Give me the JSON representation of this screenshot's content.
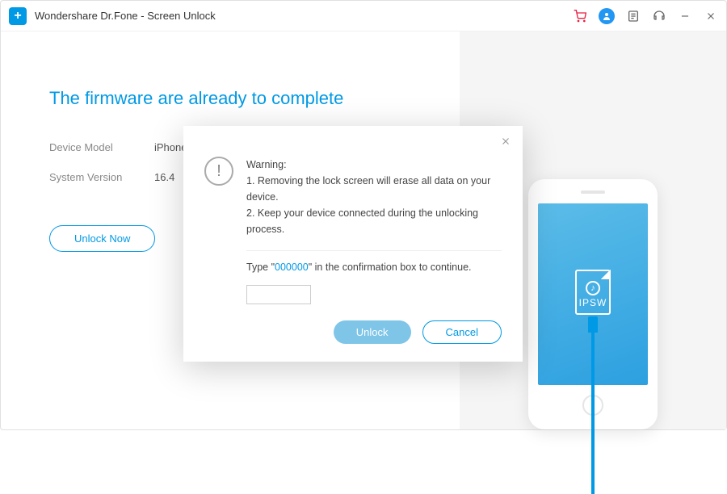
{
  "titlebar": {
    "app_name": "Wondershare Dr.Fone - Screen Unlock"
  },
  "main": {
    "headline": "The firmware are already to complete",
    "device_model_label": "Device Model",
    "device_model_value": "iPhone X",
    "system_version_label": "System Version",
    "system_version_value": "16.4",
    "unlock_now_label": "Unlock Now"
  },
  "phone": {
    "file_label": "IPSW"
  },
  "modal": {
    "warning_heading": "Warning:",
    "warning_line1": "1. Removing the lock screen will erase all data on your device.",
    "warning_line2": "2. Keep your device connected during the unlocking process.",
    "confirm_prefix": "Type \"",
    "confirm_code": "000000",
    "confirm_suffix": "\" in the confirmation box to continue.",
    "unlock_label": "Unlock",
    "cancel_label": "Cancel"
  },
  "colors": {
    "accent": "#0099e5"
  }
}
